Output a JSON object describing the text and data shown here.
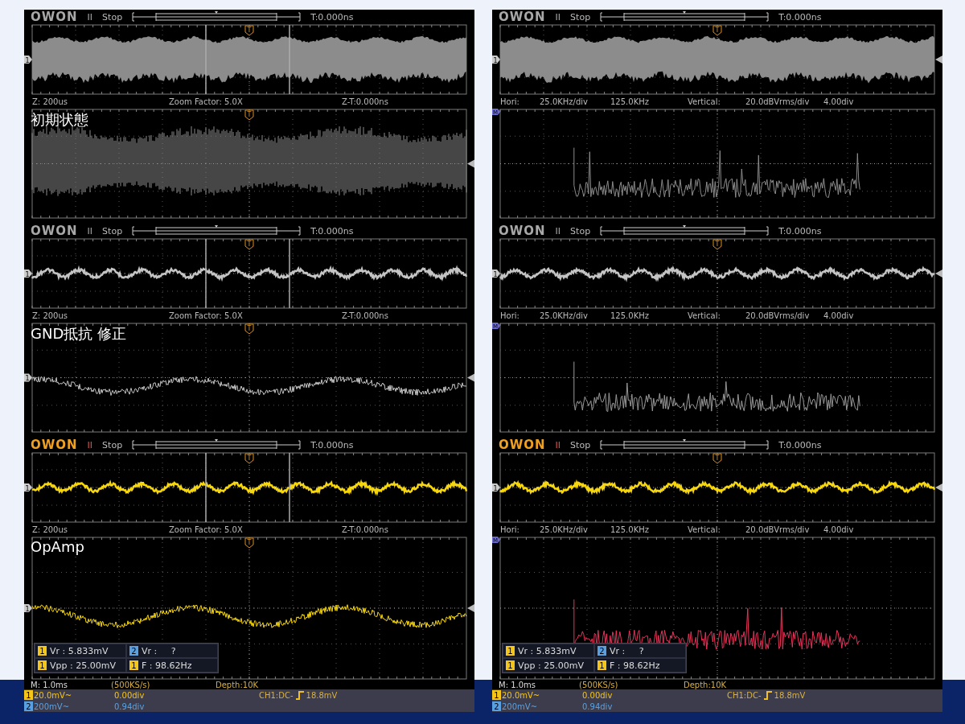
{
  "columns": [
    {
      "kind": "zoom",
      "panels": [
        {
          "caption": "初期状態",
          "header": {
            "brand": "OWON",
            "run": "II",
            "status": "Stop",
            "time": "T:0.000ns"
          },
          "main": {
            "markers": [
              {
                "kind": "channel",
                "text": "1"
              },
              {
                "kind": "trigger",
                "text": "T"
              }
            ]
          },
          "info": [
            "Z: 200us",
            "Zoom Factor: 5.0X",
            "Z-T:0.000ns"
          ],
          "second": {
            "markers": [
              {
                "kind": "trigger",
                "text": "T"
              }
            ]
          }
        },
        {
          "caption": "GND抵抗 修正",
          "header": {
            "brand": "OWON",
            "run": "II",
            "status": "Stop",
            "time": "T:0.000ns"
          },
          "main": {
            "markers": [
              {
                "kind": "channel",
                "text": "1"
              },
              {
                "kind": "trigger",
                "text": "T"
              }
            ]
          },
          "info": [
            "Z: 200us",
            "Zoom Factor: 5.0X",
            "Z-T:0.000ns"
          ],
          "second": {
            "markers": [
              {
                "kind": "channel",
                "text": "1"
              },
              {
                "kind": "trigger",
                "text": "T"
              }
            ]
          }
        },
        {
          "caption": "OpAmp",
          "header": {
            "brand": "OWON",
            "run": "II",
            "status": "Stop",
            "time": "T:0.000ns"
          },
          "main": {
            "markers": [
              {
                "kind": "channel",
                "text": "1"
              },
              {
                "kind": "trigger",
                "text": "T"
              }
            ]
          },
          "info": [
            "Z: 200us",
            "Zoom Factor: 5.0X",
            "Z-T:0.000ns"
          ],
          "second": {
            "markers": [
              {
                "kind": "channel",
                "text": "1"
              },
              {
                "kind": "trigger",
                "text": "T"
              }
            ]
          },
          "measurements": [
            {
              "channel": "1",
              "color": "#f5c518",
              "text": "Vr : 5.833mV"
            },
            {
              "channel": "2",
              "color": "#5aa0e0",
              "text": "Vr :     ?"
            },
            {
              "channel": "1",
              "color": "#f5c518",
              "text": "Vpp : 25.00mV"
            },
            {
              "channel": "1",
              "color": "#f5c518",
              "text": "F : 98.62Hz"
            }
          ],
          "footer": {
            "timebase": "M: 1.0ms",
            "rate": "(500KS/s)",
            "depth": "Depth:10K",
            "trigger": "CH1:DC-",
            "trigger_level": "18.8mV",
            "channels": [
              {
                "channel": "1",
                "color": "#f5c518",
                "scale": "20.0mV~",
                "offset": "0.00div"
              },
              {
                "channel": "2",
                "color": "#5aa0e0",
                "scale": "200mV~",
                "offset": "0.94div"
              }
            ]
          }
        }
      ]
    },
    {
      "kind": "fft",
      "panels": [
        {
          "header": {
            "brand": "OWON",
            "run": "II",
            "status": "Stop",
            "time": "T:0.000ns"
          },
          "main": {
            "markers": [
              {
                "kind": "channel",
                "text": "1"
              },
              {
                "kind": "trigger",
                "text": "T"
              }
            ]
          },
          "info": [
            "Hori:",
            "25.0KHz/div",
            "125.0KHz",
            "Vertical:",
            "20.0dBVrms/div",
            "4.00div"
          ],
          "second": {
            "markers": [
              {
                "kind": "math",
                "text": "M"
              }
            ]
          }
        },
        {
          "header": {
            "brand": "OWON",
            "run": "II",
            "status": "Stop",
            "time": "T:0.000ns"
          },
          "main": {
            "markers": [
              {
                "kind": "channel",
                "text": "1"
              },
              {
                "kind": "trigger",
                "text": "T"
              }
            ]
          },
          "info": [
            "Hori:",
            "25.0KHz/div",
            "125.0KHz",
            "Vertical:",
            "20.0dBVrms/div",
            "4.00div"
          ],
          "second": {
            "markers": [
              {
                "kind": "math",
                "text": "M"
              }
            ]
          }
        },
        {
          "header": {
            "brand": "OWON",
            "run": "II",
            "status": "Stop",
            "time": "T:0.000ns"
          },
          "main": {
            "markers": [
              {
                "kind": "channel",
                "text": "1"
              },
              {
                "kind": "trigger",
                "text": "T"
              }
            ]
          },
          "info": [
            "Hori:",
            "25.0KHz/div",
            "125.0KHz",
            "Vertical:",
            "20.0dBVrms/div",
            "4.00div"
          ],
          "second": {
            "markers": [
              {
                "kind": "math",
                "text": "M"
              }
            ]
          },
          "measurements": [
            {
              "channel": "1",
              "color": "#f5c518",
              "text": "Vr : 5.833mV"
            },
            {
              "channel": "2",
              "color": "#5aa0e0",
              "text": "Vr :     ?"
            },
            {
              "channel": "1",
              "color": "#f5c518",
              "text": "Vpp : 25.00mV"
            },
            {
              "channel": "1",
              "color": "#f5c518",
              "text": "F : 98.62Hz"
            }
          ],
          "footer": {
            "timebase": "M: 1.0ms",
            "rate": "(500KS/s)",
            "depth": "Depth:10K",
            "trigger": "CH1:DC-",
            "trigger_level": "18.8mV",
            "channels": [
              {
                "channel": "1",
                "color": "#f5c518",
                "scale": "20.0mV~",
                "offset": "0.00div"
              },
              {
                "channel": "2",
                "color": "#5aa0e0",
                "scale": "200mV~",
                "offset": "0.94div"
              }
            ]
          }
        }
      ]
    }
  ]
}
